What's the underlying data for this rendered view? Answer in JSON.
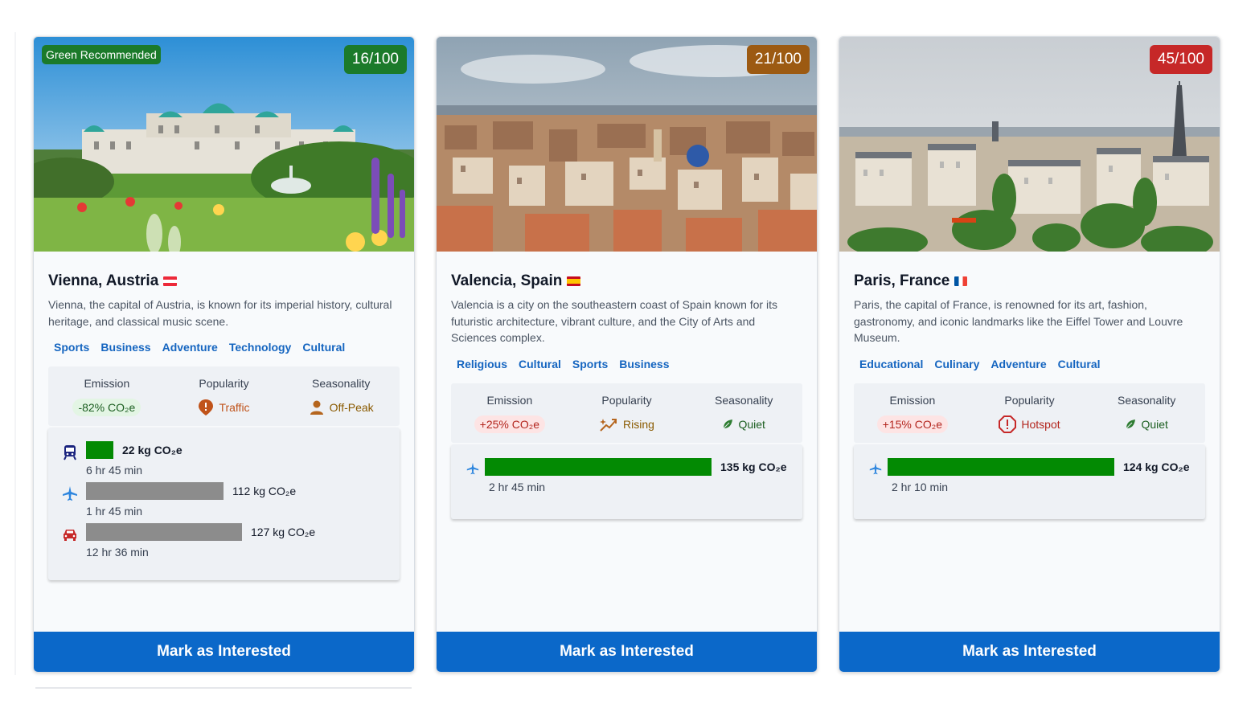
{
  "cards": [
    {
      "score": "16/100",
      "score_color": "#1b7a2a",
      "badge": "Green Recommended",
      "title": "Vienna, Austria",
      "flag": "austria-flag-icon",
      "description": "Vienna, the capital of Austria, is known for its imperial history, cultural heritage, and classical music scene.",
      "tags": [
        "Sports",
        "Business",
        "Adventure",
        "Technology",
        "Cultural"
      ],
      "stats": {
        "emission_label": "Emission",
        "emission_value": "-82% CO₂e",
        "popularity_label": "Popularity",
        "popularity_value": "Traffic",
        "seasonality_label": "Seasonality",
        "seasonality_value": "Off-Peak"
      },
      "transport": [
        {
          "mode": "train-icon",
          "amount": "22 kg CO₂e",
          "duration": "6 hr 45 min",
          "fraction": 0.173
        },
        {
          "mode": "plane-icon",
          "amount": "112 kg CO₂e",
          "duration": "1 hr 45 min",
          "fraction": 0.882
        },
        {
          "mode": "car-icon",
          "amount": "127 kg CO₂e",
          "duration": "12 hr 36 min",
          "fraction": 1.0
        }
      ],
      "button": "Mark as Interested"
    },
    {
      "score": "21/100",
      "score_color": "#9c5a12",
      "title": "Valencia, Spain",
      "flag": "spain-flag-icon",
      "description": "Valencia is a city on the southeastern coast of Spain known for its futuristic architecture, vibrant culture, and the City of Arts and Sciences complex.",
      "tags": [
        "Religious",
        "Cultural",
        "Sports",
        "Business"
      ],
      "stats": {
        "emission_label": "Emission",
        "emission_value": "+25% CO₂e",
        "popularity_label": "Popularity",
        "popularity_value": "Rising",
        "seasonality_label": "Seasonality",
        "seasonality_value": "Quiet"
      },
      "transport": [
        {
          "mode": "plane-icon",
          "amount": "135 kg CO₂e",
          "duration": "2 hr 45 min",
          "fraction": 1.0
        }
      ],
      "button": "Mark as Interested"
    },
    {
      "score": "45/100",
      "score_color": "#c62828",
      "title": "Paris, France",
      "flag": "france-flag-icon",
      "description": "Paris, the capital of France, is renowned for its art, fashion, gastronomy, and iconic landmarks like the Eiffel Tower and Louvre Museum.",
      "tags": [
        "Educational",
        "Culinary",
        "Adventure",
        "Cultural"
      ],
      "stats": {
        "emission_label": "Emission",
        "emission_value": "+15% CO₂e",
        "popularity_label": "Popularity",
        "popularity_value": "Hotspot",
        "seasonality_label": "Seasonality",
        "seasonality_value": "Quiet"
      },
      "transport": [
        {
          "mode": "plane-icon",
          "amount": "124 kg CO₂e",
          "duration": "2 hr 10 min",
          "fraction": 1.0
        }
      ],
      "button": "Mark as Interested"
    }
  ],
  "colors": {
    "best_bar": "#038a03",
    "other_bar": "#8c8c8c",
    "button": "#0b68c9",
    "tag": "#1565c0"
  }
}
